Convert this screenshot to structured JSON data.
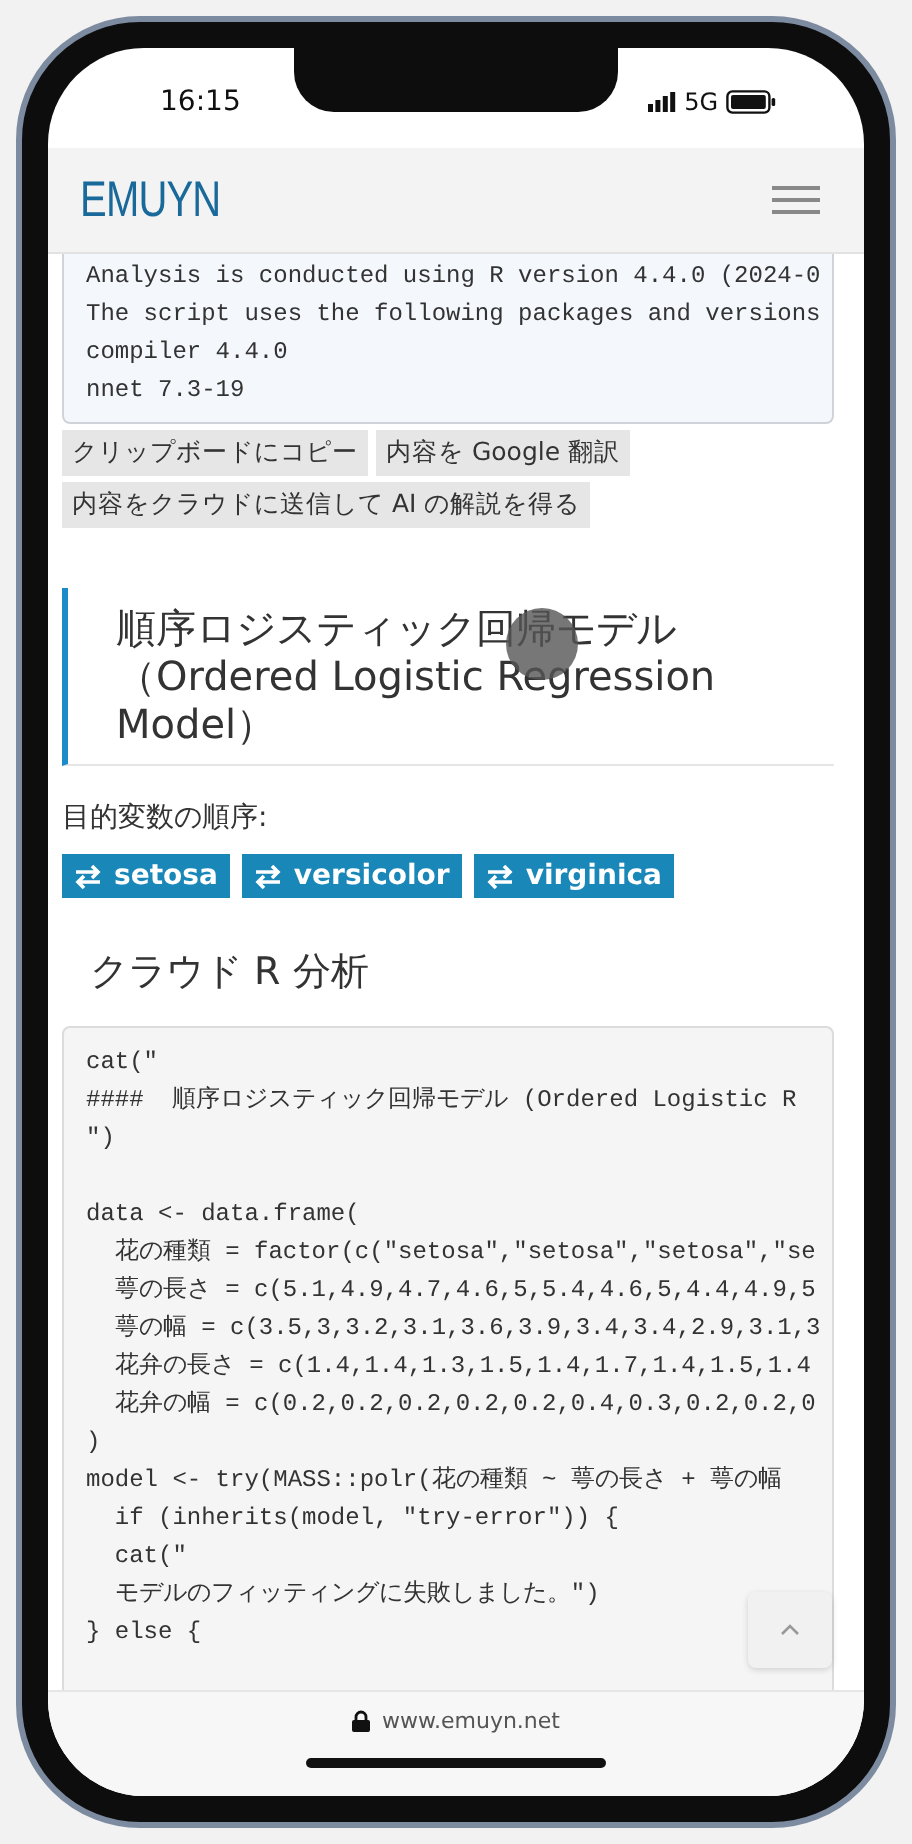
{
  "status_bar": {
    "time": "16:15",
    "network": "5G"
  },
  "header": {
    "logo": "EMUYN"
  },
  "output_box": {
    "text": "Analysis is conducted using R version 4.4.0 (2024-0\nThe script uses the following packages and versions\ncompiler 4.4.0\nnnet 7.3-19"
  },
  "action_buttons": [
    "クリップボードにコピー",
    "内容を Google 翻訳",
    "内容をクラウドに送信して AI の解説を得る"
  ],
  "section_heading": "順序ロジスティック回帰モデル（Ordered Logistic Regression Model）",
  "order_label": "目的変数の順序:",
  "order_tags": [
    "setosa",
    "versicolor",
    "virginica"
  ],
  "subheading": "クラウド R 分析",
  "code": "cat(\"\n####  順序ロジスティック回帰モデル (Ordered Logistic R\n\")\n\ndata <- data.frame(\n  花の種類 = factor(c(\"setosa\",\"setosa\",\"setosa\",\"se\n  萼の長さ = c(5.1,4.9,4.7,4.6,5,5.4,4.6,5,4.4,4.9,5\n  萼の幅 = c(3.5,3,3.2,3.1,3.6,3.9,3.4,3.4,2.9,3.1,3\n  花弁の長さ = c(1.4,1.4,1.3,1.5,1.4,1.7,1.4,1.5,1.4\n  花弁の幅 = c(0.2,0.2,0.2,0.2,0.2,0.4,0.3,0.2,0.2,0\n)\nmodel <- try(MASS::polr(花の種類 ~ 萼の長さ + 萼の幅\n  if (inherits(model, \"try-error\")) {\n  cat(\"\n  モデルのフィッティングに失敗しました。\")\n} else {",
  "address_bar": {
    "url": "www.emuyn.net"
  }
}
